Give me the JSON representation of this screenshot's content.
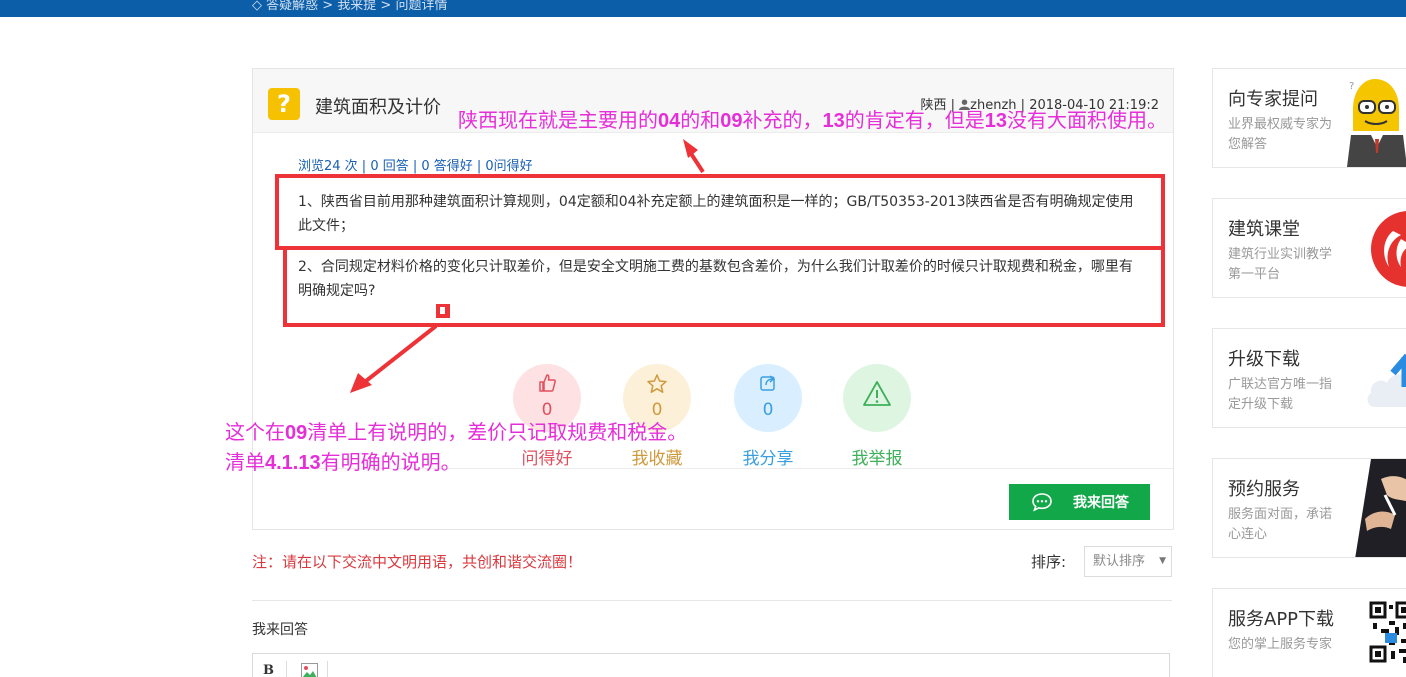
{
  "topbar": {
    "breadcrumb": "◇ 答疑解惑 > 我来提 > 问题详情"
  },
  "question": {
    "title": "建筑面积及计价",
    "region": "陕西",
    "author": "zhenzh",
    "timestamp": "2018-04-10 21:19:2",
    "stats": "浏览24 次 | 0 回答 | 0 答得好 | 0问得好",
    "paragraphs": [
      "1、陕西省目前用那种建筑面积计算规则，04定额和04补充定额上的建筑面积是一样的；GB/T50353-2013陕西省是否有明确规定使用此文件；",
      "2、合同规定材料价格的变化只计取差价，但是安全文明施工费的基数包含差价，为什么我们计取差价的时候只计取规费和税金，哪里有明确规定吗?"
    ]
  },
  "actions": [
    {
      "count": "0",
      "label": "问得好",
      "icon": "thumbs-up-icon"
    },
    {
      "count": "0",
      "label": "我收藏",
      "icon": "star-icon"
    },
    {
      "count": "0",
      "label": "我分享",
      "icon": "share-icon"
    },
    {
      "count": "",
      "label": "我举报",
      "icon": "warning-icon"
    }
  ],
  "answer_button": "我来回答",
  "note": "注：请在以下交流中文明用语，共创和谐交流圈！",
  "sort": {
    "label": "排序:",
    "selected": "默认排序"
  },
  "my_answer_label": "我来回答",
  "editor": {
    "bold": "B"
  },
  "sidebar": [
    {
      "title": "向专家提问",
      "desc": "业界最权威专家为您解答"
    },
    {
      "title": "建筑课堂",
      "desc": "建筑行业实训教学第一平台"
    },
    {
      "title": "升级下载",
      "desc": "广联达官方唯一指定升级下载"
    },
    {
      "title": "预约服务",
      "desc": "服务面对面，承诺心连心"
    },
    {
      "title": "服务APP下载",
      "desc": "您的掌上服务专家"
    }
  ],
  "annotations": {
    "top": [
      "陕西现在就是主要用的",
      "04",
      "的和",
      "09",
      "补充的，",
      "13",
      "的肯定有，但是",
      "13",
      "没有大面积使用。"
    ],
    "line1": [
      "这个在",
      "09",
      "清单上有说明的，差价只记取规费和税金。"
    ],
    "line2": [
      "清单",
      "4.1.13",
      "有明确的说明。"
    ]
  },
  "colors": {
    "topbar": "#0d5ea8",
    "annotation": "#e62ed8",
    "highlight_box": "#ee3338",
    "answer_button": "#12a84a",
    "note": "#d9393e"
  }
}
